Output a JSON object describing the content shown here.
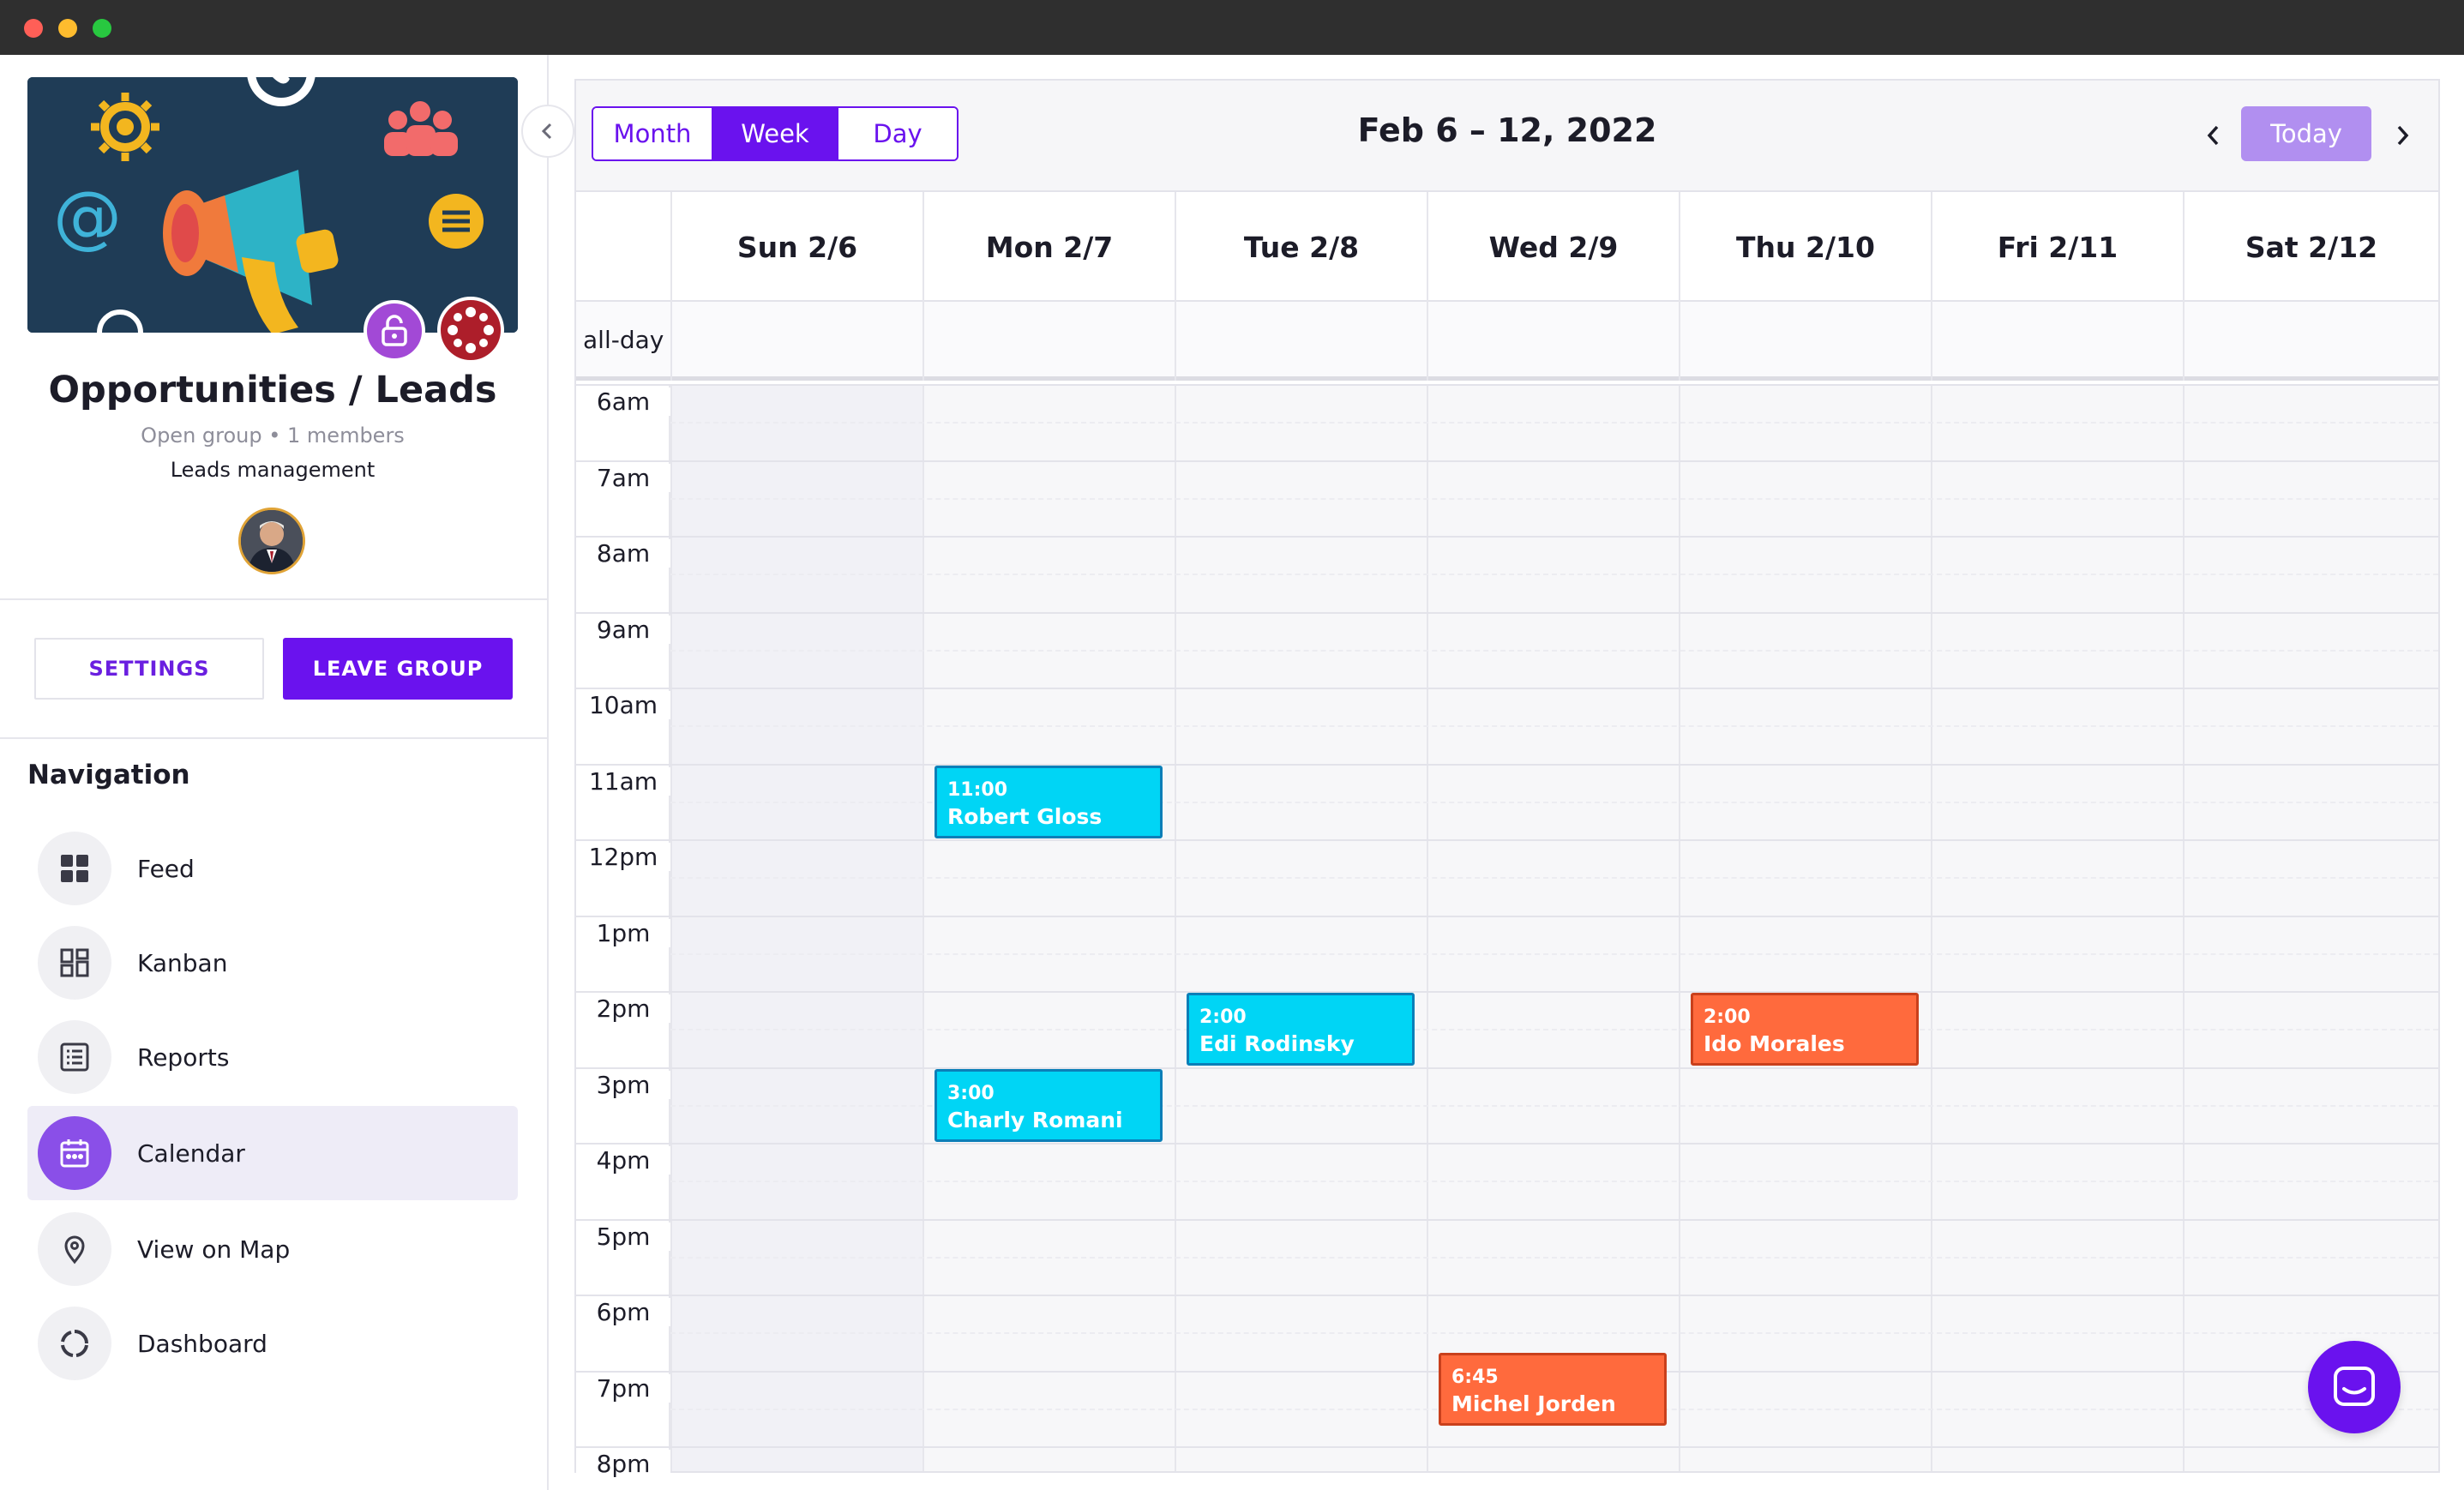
{
  "window": {
    "controls": [
      "close",
      "minimize",
      "maximize"
    ]
  },
  "group": {
    "title": "Opportunities / Leads",
    "meta": "Open group • 1 members",
    "description": "Leads management",
    "settings_label": "SETTINGS",
    "leave_label": "LEAVE GROUP"
  },
  "navigation": {
    "heading": "Navigation",
    "items": [
      {
        "label": "Feed",
        "icon": "grid-icon",
        "active": false
      },
      {
        "label": "Kanban",
        "icon": "kanban-icon",
        "active": false
      },
      {
        "label": "Reports",
        "icon": "list-icon",
        "active": false
      },
      {
        "label": "Calendar",
        "icon": "calendar-icon",
        "active": true
      },
      {
        "label": "View on Map",
        "icon": "map-pin-icon",
        "active": false
      },
      {
        "label": "Dashboard",
        "icon": "donut-icon",
        "active": false
      }
    ]
  },
  "calendar": {
    "views": [
      "Month",
      "Week",
      "Day"
    ],
    "active_view": "Week",
    "range_title": "Feb 6 – 12, 2022",
    "today_label": "Today",
    "days": [
      "Sun 2/6",
      "Mon 2/7",
      "Tue 2/8",
      "Wed 2/9",
      "Thu 2/10",
      "Fri 2/11",
      "Sat 2/12"
    ],
    "allday_label": "all-day",
    "hours": [
      "6am",
      "7am",
      "8am",
      "9am",
      "10am",
      "11am",
      "12pm",
      "1pm",
      "2pm",
      "3pm",
      "4pm",
      "5pm",
      "6pm",
      "7pm",
      "8pm"
    ],
    "events": [
      {
        "day": "Mon 2/7",
        "start": "11:00",
        "time": "11:00",
        "name": "Robert Gloss",
        "color": "cyan"
      },
      {
        "day": "Tue 2/8",
        "start": "14:00",
        "time": "2:00",
        "name": "Edi Rodinsky",
        "color": "cyan"
      },
      {
        "day": "Thu 2/10",
        "start": "14:00",
        "time": "2:00",
        "name": "Ido Morales",
        "color": "orange"
      },
      {
        "day": "Mon 2/7",
        "start": "15:00",
        "time": "3:00",
        "name": "Charly Romani",
        "color": "cyan"
      },
      {
        "day": "Wed 2/9",
        "start": "18:45",
        "time": "6:45",
        "name": "Michel Jorden",
        "color": "orange"
      }
    ]
  },
  "colors": {
    "accent": "#6a12ee",
    "today_button": "#b18ff0",
    "event_cyan": "#00d5f5",
    "event_orange": "#ff6a3d"
  }
}
